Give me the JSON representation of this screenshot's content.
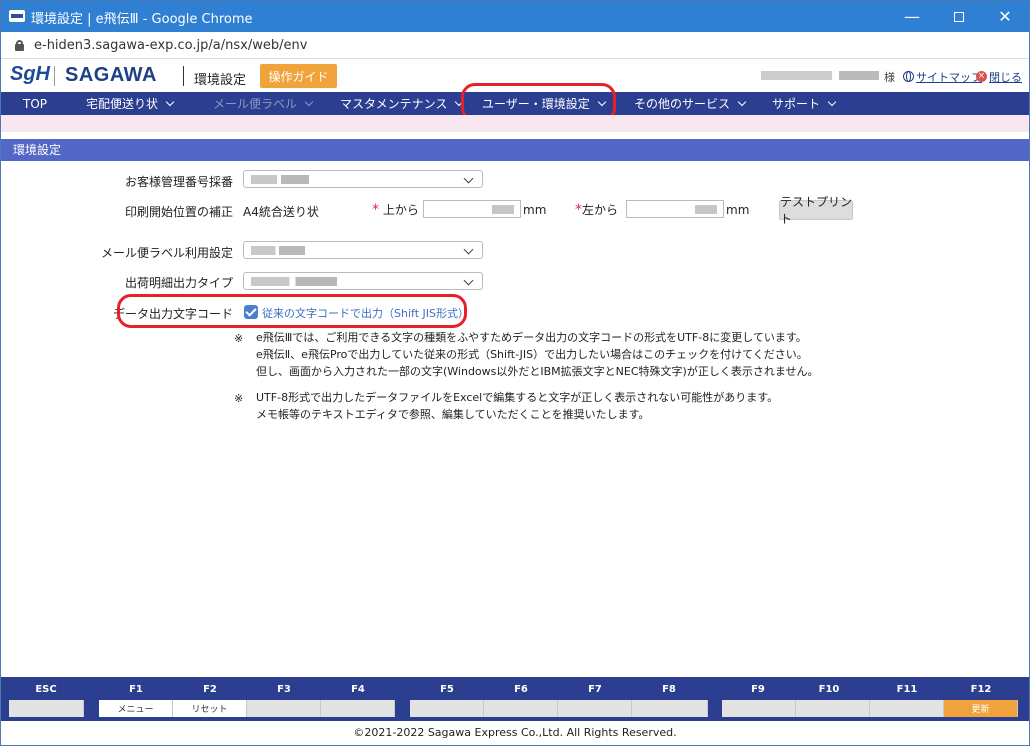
{
  "window": {
    "title": "環境設定 | e飛伝Ⅲ - Google Chrome",
    "url": "e-hiden3.sagawa-exp.co.jp/a/nsx/web/env"
  },
  "header": {
    "logo_sgh": "SgH",
    "logo_text": "SAGAWA",
    "page_label": "環境設定",
    "guide_button": "操作ガイド",
    "user_suffix": "様",
    "sitemap": "サイトマップ",
    "close": "閉じる"
  },
  "nav": [
    {
      "label": "TOP"
    },
    {
      "label": "宅配便送り状"
    },
    {
      "label": "メール便ラベル"
    },
    {
      "label": "マスタメンテナンス"
    },
    {
      "label": "ユーザー・環境設定"
    },
    {
      "label": "その他のサービス"
    },
    {
      "label": "サポート"
    }
  ],
  "section": {
    "title": "環境設定"
  },
  "form": {
    "customer_no_label": "お客様管理番号採番",
    "print_pos_label": "印刷開始位置の補正",
    "print_pos_type": "A4統合送り状",
    "top_label": "上から",
    "left_label": "左から",
    "unit": "mm",
    "required_mark": "*",
    "test_print": "テストプリント",
    "mail_label_label": "メール便ラベル利用設定",
    "detail_output_label": "出荷明細出力タイプ",
    "data_output_label": "データ出力文字コード",
    "data_output_checkbox": "従来の文字コードで出力（Shift JIS形式）",
    "data_output_checked": true
  },
  "notes": {
    "mark": "※",
    "note1_line1": "e飛伝Ⅲでは、ご利用できる文字の種類をふやすためデータ出力の文字コードの形式をUTF-8に変更しています。",
    "note1_line2": "e飛伝Ⅱ、e飛伝Proで出力していた従来の形式（Shift-JIS）で出力したい場合はこのチェックを付けてください。",
    "note1_line3": "但し、画面から入力された一部の文字(Windows以外だとIBM拡張文字とNEC特殊文字)が正しく表示されません。",
    "note2_line1": "UTF-8形式で出力したデータファイルをExcelで編集すると文字が正しく表示されない可能性があります。",
    "note2_line2": "メモ帳等のテキストエディタで参照、編集していただくことを推奨いたします。"
  },
  "fkeys": {
    "esc": "ESC",
    "f1": "F1",
    "f2": "F2",
    "f3": "F3",
    "f4": "F4",
    "f5": "F5",
    "f6": "F6",
    "f7": "F7",
    "f8": "F8",
    "f9": "F9",
    "f10": "F10",
    "f11": "F11",
    "f12": "F12",
    "f1_label": "メニュー",
    "f2_label": "リセット",
    "f12_label": "更新"
  },
  "footer": "©2021-2022 Sagawa Express Co.,Ltd. All Rights Reserved.",
  "colors": {
    "nav": "#2b3e8f",
    "section": "#5367c6",
    "accent": "#f0a33b",
    "highlight": "#e8202a"
  }
}
